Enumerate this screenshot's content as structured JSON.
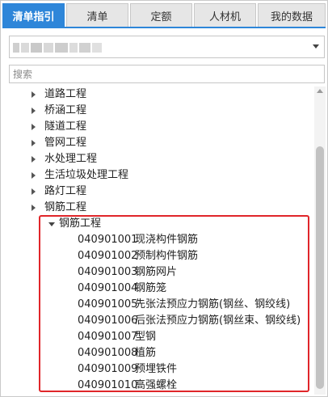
{
  "tabs": [
    {
      "label": "清单指引",
      "active": true
    },
    {
      "label": "清单",
      "active": false
    },
    {
      "label": "定额",
      "active": false
    },
    {
      "label": "人材机",
      "active": false
    },
    {
      "label": "我的数据",
      "active": false
    }
  ],
  "search": {
    "placeholder": "搜索"
  },
  "tree": {
    "top_items": [
      {
        "label": "道路工程"
      },
      {
        "label": "桥涵工程"
      },
      {
        "label": "隧道工程"
      },
      {
        "label": "管网工程"
      },
      {
        "label": "水处理工程"
      },
      {
        "label": "生活垃圾处理工程"
      },
      {
        "label": "路灯工程"
      },
      {
        "label": "钢筋工程"
      }
    ],
    "expanded_group": {
      "label": "钢筋工程"
    },
    "children": [
      {
        "code": "040901001",
        "name": "现浇构件钢筋"
      },
      {
        "code": "040901002",
        "name": "预制构件钢筋"
      },
      {
        "code": "040901003",
        "name": "钢筋网片"
      },
      {
        "code": "040901004",
        "name": "钢筋笼"
      },
      {
        "code": "040901005",
        "name": "先张法预应力钢筋(钢丝、钢绞线)"
      },
      {
        "code": "040901006",
        "name": "后张法预应力钢筋(钢丝束、钢绞线)"
      },
      {
        "code": "040901007",
        "name": "型钢"
      },
      {
        "code": "040901008",
        "name": "植筋"
      },
      {
        "code": "040901009",
        "name": "预埋铁件"
      },
      {
        "code": "040901010",
        "name": "高强螺栓"
      }
    ]
  },
  "colors": {
    "accent": "#2e86d9",
    "highlight": "#e0262a"
  }
}
